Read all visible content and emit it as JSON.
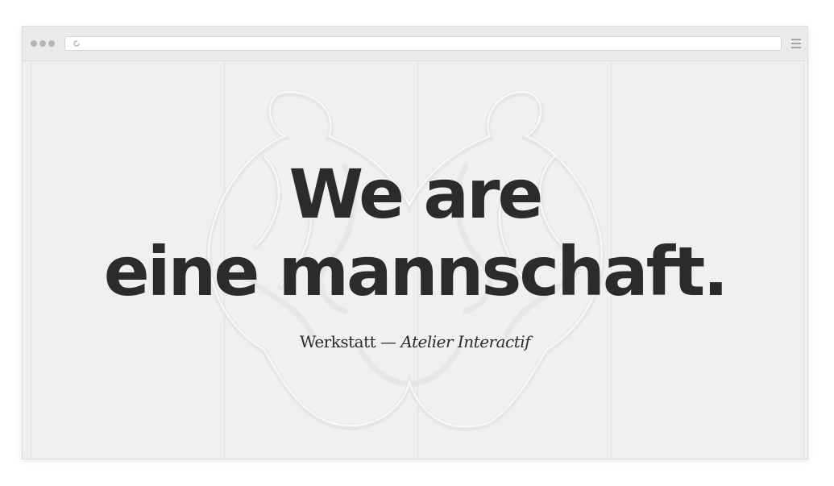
{
  "browser": {
    "address": "",
    "icons": [
      "window-controls-icon",
      "reload-icon",
      "menu-icon"
    ]
  },
  "hero": {
    "line1": "We are",
    "line2": "eine mannschaft.",
    "tagline_studio": "Werkstatt",
    "tagline_separator": " — ",
    "tagline_project": "Atelier Interactif"
  },
  "colors": {
    "background": "#f0f0f0",
    "text": "#2b2b2b",
    "grid": "#e0e0e0"
  }
}
